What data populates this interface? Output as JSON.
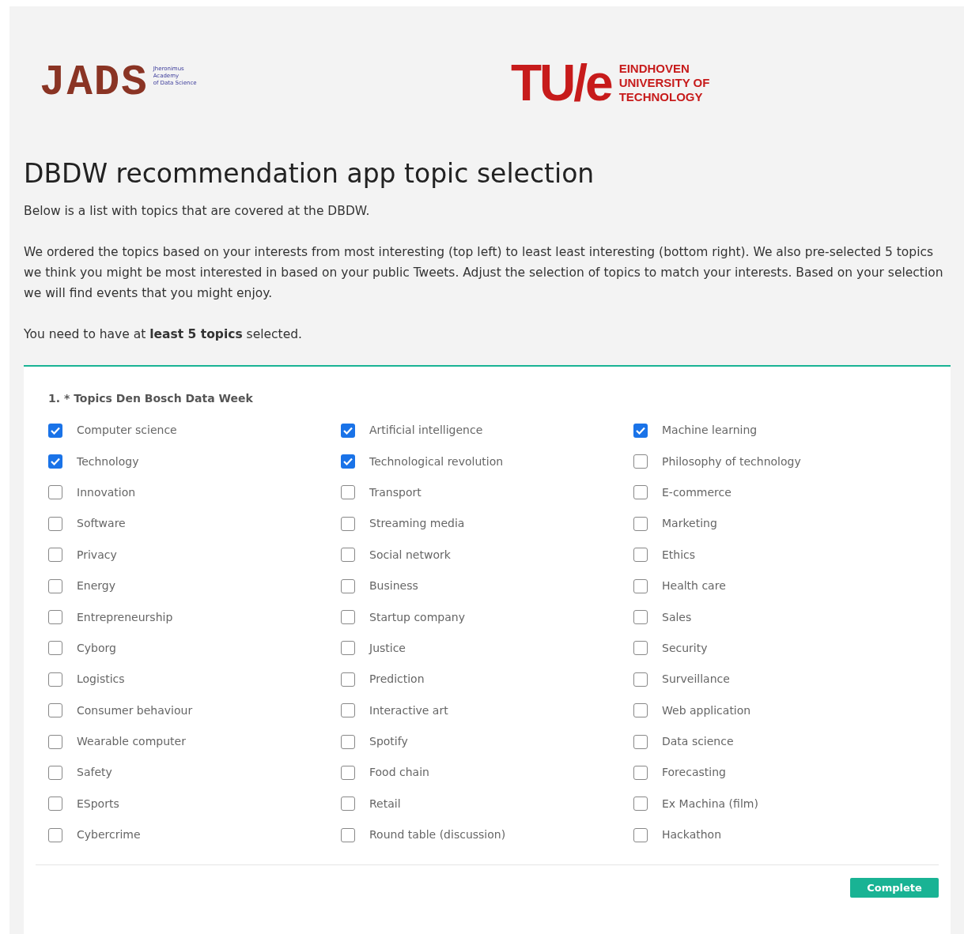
{
  "logos": {
    "jads": {
      "mark": "JADS",
      "subtitle": [
        "Jheronimus",
        "Academy",
        "of Data Science"
      ]
    },
    "tue": {
      "mark": "TU/e",
      "subtitle": [
        "EINDHOVEN",
        "UNIVERSITY OF",
        "TECHNOLOGY"
      ]
    }
  },
  "title": "DBDW recommendation app topic selection",
  "paragraphs": [
    "Below is a list with topics that are covered at the DBDW.",
    "We ordered the topics based on your interests from most interesting (top left) to least least interesting (bottom right). We also pre-selected 5 topics we think you might be most interested in based on your public Tweets. Adjust the selection of topics to match your interests. Based on your selection we will find events that you might enjoy.",
    "You need to have at **least 5 topics** selected."
  ],
  "question": {
    "label": "1. * Topics Den Bosch Data Week",
    "options": [
      {
        "label": "Computer science",
        "checked": true
      },
      {
        "label": "Artificial intelligence",
        "checked": true
      },
      {
        "label": "Machine learning",
        "checked": true
      },
      {
        "label": "Technology",
        "checked": true
      },
      {
        "label": "Technological revolution",
        "checked": true
      },
      {
        "label": "Philosophy of technology",
        "checked": false
      },
      {
        "label": "Innovation",
        "checked": false
      },
      {
        "label": "Transport",
        "checked": false
      },
      {
        "label": "E-commerce",
        "checked": false
      },
      {
        "label": "Software",
        "checked": false
      },
      {
        "label": "Streaming media",
        "checked": false
      },
      {
        "label": "Marketing",
        "checked": false
      },
      {
        "label": "Privacy",
        "checked": false
      },
      {
        "label": "Social network",
        "checked": false
      },
      {
        "label": "Ethics",
        "checked": false
      },
      {
        "label": "Energy",
        "checked": false
      },
      {
        "label": "Business",
        "checked": false
      },
      {
        "label": "Health care",
        "checked": false
      },
      {
        "label": "Entrepreneurship",
        "checked": false
      },
      {
        "label": "Startup company",
        "checked": false
      },
      {
        "label": "Sales",
        "checked": false
      },
      {
        "label": "Cyborg",
        "checked": false
      },
      {
        "label": "Justice",
        "checked": false
      },
      {
        "label": "Security",
        "checked": false
      },
      {
        "label": "Logistics",
        "checked": false
      },
      {
        "label": "Prediction",
        "checked": false
      },
      {
        "label": "Surveillance",
        "checked": false
      },
      {
        "label": "Consumer behaviour",
        "checked": false
      },
      {
        "label": "Interactive art",
        "checked": false
      },
      {
        "label": "Web application",
        "checked": false
      },
      {
        "label": "Wearable computer",
        "checked": false
      },
      {
        "label": "Spotify",
        "checked": false
      },
      {
        "label": "Data science",
        "checked": false
      },
      {
        "label": "Safety",
        "checked": false
      },
      {
        "label": "Food chain",
        "checked": false
      },
      {
        "label": "Forecasting",
        "checked": false
      },
      {
        "label": "ESports",
        "checked": false
      },
      {
        "label": "Retail",
        "checked": false
      },
      {
        "label": "Ex Machina (film)",
        "checked": false
      },
      {
        "label": "Cybercrime",
        "checked": false
      },
      {
        "label": "Round table (discussion)",
        "checked": false
      },
      {
        "label": "Hackathon",
        "checked": false
      }
    ]
  },
  "buttons": [
    "Complete"
  ]
}
